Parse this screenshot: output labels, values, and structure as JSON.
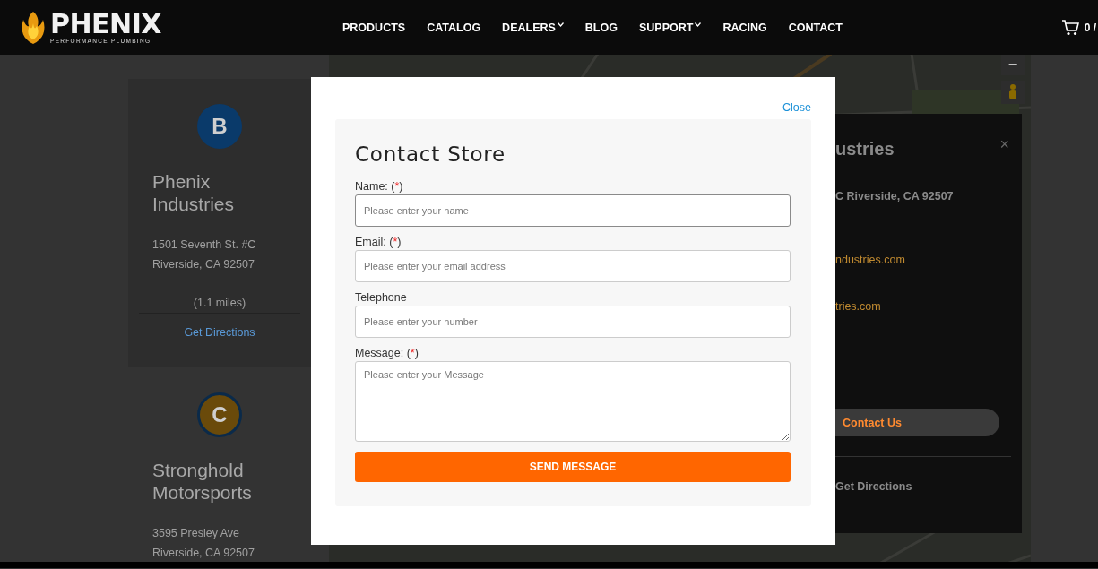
{
  "header": {
    "logo": {
      "name": "PHENIX",
      "tagline": "PERFORMANCE PLUMBING"
    },
    "nav": [
      {
        "label": "PRODUCTS",
        "dropdown": false
      },
      {
        "label": "CATALOG",
        "dropdown": false
      },
      {
        "label": "DEALERS",
        "dropdown": true
      },
      {
        "label": "BLOG",
        "dropdown": false
      },
      {
        "label": "SUPPORT",
        "dropdown": true
      },
      {
        "label": "RACING",
        "dropdown": false
      },
      {
        "label": "CONTACT",
        "dropdown": false
      }
    ],
    "cart": "0 /"
  },
  "stores": [
    {
      "letter": "B",
      "color": "#0a3a6a",
      "name": "Phenix Industries",
      "address": [
        "1501 Seventh St. #C",
        "Riverside, CA 92507"
      ],
      "distance": "(1.1 miles)",
      "directions": "Get Directions",
      "selected": true
    },
    {
      "letter": "C",
      "color": "#6a4a0a",
      "name": "Stronghold Motorsports",
      "address": [
        "3595 Presley Ave",
        "Riverside, CA 92507"
      ],
      "selected": false
    }
  ],
  "info_window": {
    "title": "ustries",
    "address": "C Riverside, CA 92507",
    "links": [
      "ndustries.com",
      "tries.com"
    ],
    "contact_button": "Contact Us",
    "directions": "Get Directions",
    "close": "×"
  },
  "map_controls": {
    "zoom_out": "−"
  },
  "modal": {
    "close": "Close",
    "title": "Contact Store",
    "fields": [
      {
        "kind": "input",
        "label": "Name:",
        "required": "(*)",
        "placeholder": "Please enter your name",
        "focused": true
      },
      {
        "kind": "input",
        "label": "Email:",
        "required": "(*)",
        "placeholder": "Please enter your email address",
        "focused": false
      },
      {
        "kind": "input",
        "label": "Telephone",
        "placeholder": "Please enter your number",
        "focused": false
      },
      {
        "kind": "textarea",
        "label": "Message:",
        "required": "(*)",
        "placeholder": "Please enter your Message",
        "focused": false
      }
    ],
    "submit": "SEND MESSAGE"
  }
}
